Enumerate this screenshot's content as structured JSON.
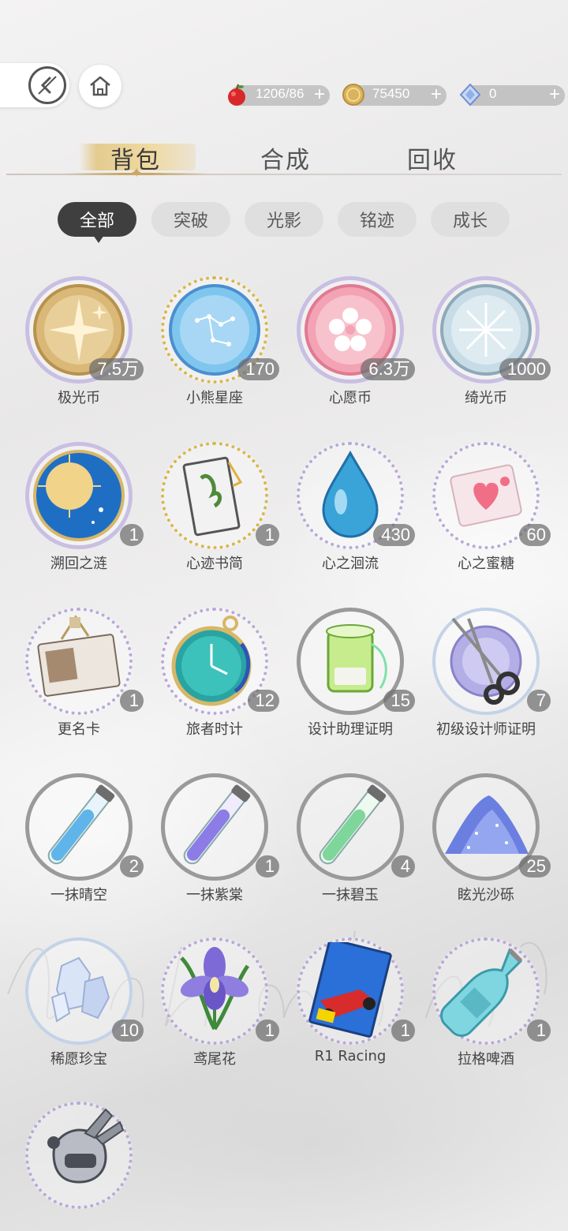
{
  "header": {
    "back_icon": "back-arrow-icon",
    "home_icon": "home-icon"
  },
  "currencies": [
    {
      "icon": "apple-stamina-icon",
      "value": "1206/86",
      "plus": "+"
    },
    {
      "icon": "gold-coin-icon",
      "value": "75450",
      "plus": "+"
    },
    {
      "icon": "diamond-gem-icon",
      "value": "0",
      "plus": "+"
    }
  ],
  "tabs": [
    {
      "label": "背包",
      "active": true
    },
    {
      "label": "合成",
      "active": false
    },
    {
      "label": "回收",
      "active": false
    }
  ],
  "filters": [
    {
      "label": "全部",
      "active": true
    },
    {
      "label": "突破",
      "active": false
    },
    {
      "label": "光影",
      "active": false
    },
    {
      "label": "铭迹",
      "active": false
    },
    {
      "label": "成长",
      "active": false
    }
  ],
  "items": [
    {
      "name": "极光币",
      "count": "7.5万",
      "icon": "aurora-coin-icon"
    },
    {
      "name": "小熊星座",
      "count": "170",
      "icon": "ursa-minor-coin-icon"
    },
    {
      "name": "心愿币",
      "count": "6.3万",
      "icon": "wish-coin-icon"
    },
    {
      "name": "绮光币",
      "count": "1000",
      "icon": "radiance-coin-icon"
    },
    {
      "name": "溯回之涟",
      "count": "1",
      "icon": "celestial-orb-icon"
    },
    {
      "name": "心迹书简",
      "count": "1",
      "icon": "letter-card-icon"
    },
    {
      "name": "心之洄流",
      "count": "430",
      "icon": "water-drop-icon"
    },
    {
      "name": "心之蜜糖",
      "count": "60",
      "icon": "candy-icon"
    },
    {
      "name": "更名卡",
      "count": "1",
      "icon": "rename-card-icon"
    },
    {
      "name": "旅者时计",
      "count": "12",
      "icon": "pocket-watch-icon"
    },
    {
      "name": "设计助理证明",
      "count": "15",
      "icon": "thread-spool-icon"
    },
    {
      "name": "初级设计师证明",
      "count": "7",
      "icon": "scissors-icon"
    },
    {
      "name": "一抹晴空",
      "count": "2",
      "icon": "blue-vial-icon"
    },
    {
      "name": "一抹紫棠",
      "count": "1",
      "icon": "purple-vial-icon"
    },
    {
      "name": "一抹碧玉",
      "count": "4",
      "icon": "green-vial-icon"
    },
    {
      "name": "眩光沙砾",
      "count": "25",
      "icon": "glitter-sand-icon"
    },
    {
      "name": "稀愿珍宝",
      "count": "10",
      "icon": "crystal-icon"
    },
    {
      "name": "鸢尾花",
      "count": "1",
      "icon": "iris-flower-icon"
    },
    {
      "name": "R1 Racing",
      "count": "1",
      "icon": "racing-magazine-icon"
    },
    {
      "name": "拉格啤酒",
      "count": "1",
      "icon": "beer-bottle-icon"
    },
    {
      "name": "",
      "count": "",
      "icon": "robot-figure-icon"
    }
  ],
  "colors": {
    "filter_active": "#3f3f3f",
    "filter_inactive": "#e0dfdf",
    "tab_accent": "#c9a765",
    "count_badge": "#6e6e6e"
  }
}
